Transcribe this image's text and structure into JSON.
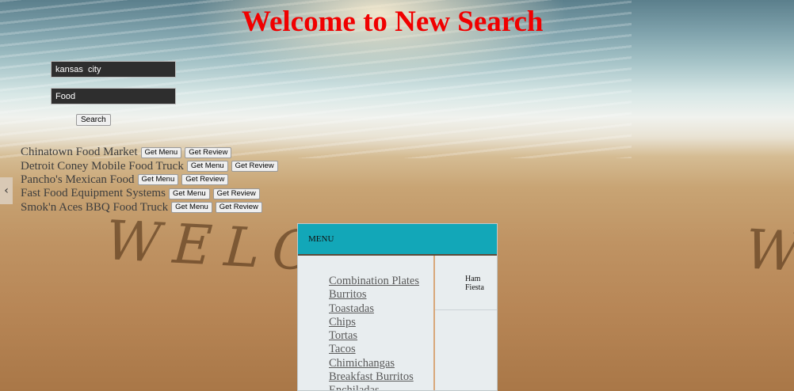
{
  "page": {
    "title": "Welcome to New Search"
  },
  "search": {
    "location_value": "kansas  city",
    "term_value": "Food",
    "button_label": "Search"
  },
  "results": [
    {
      "name": "Chinatown Food Market",
      "menu_label": "Get Menu",
      "review_label": "Get Review"
    },
    {
      "name": "Detroit Coney Mobile Food Truck",
      "menu_label": "Get Menu",
      "review_label": "Get Review"
    },
    {
      "name": "Pancho's Mexican Food",
      "menu_label": "Get Menu",
      "review_label": "Get Review"
    },
    {
      "name": "Fast Food Equipment Systems",
      "menu_label": "Get Menu",
      "review_label": "Get Review"
    },
    {
      "name": "Smok'n Aces BBQ Food Truck",
      "menu_label": "Get Menu",
      "review_label": "Get Review"
    }
  ],
  "nav": {
    "prev_icon": "chevron-left-icon",
    "prev_glyph": "‹"
  },
  "menu": {
    "header": "MENU",
    "items": [
      "Combination Plates",
      "Burritos",
      "Toastadas",
      "Chips",
      "Tortas",
      "Tacos",
      "Chimichangas",
      "Breakfast Burritos",
      "Enchiladas"
    ],
    "side_items": [
      "Ham",
      "Fiesta"
    ]
  },
  "background": {
    "sand_text": "WELCOME",
    "sand_text_partial": "W"
  },
  "colors": {
    "title": "#f00000",
    "menu_header": "#12a7b8"
  }
}
